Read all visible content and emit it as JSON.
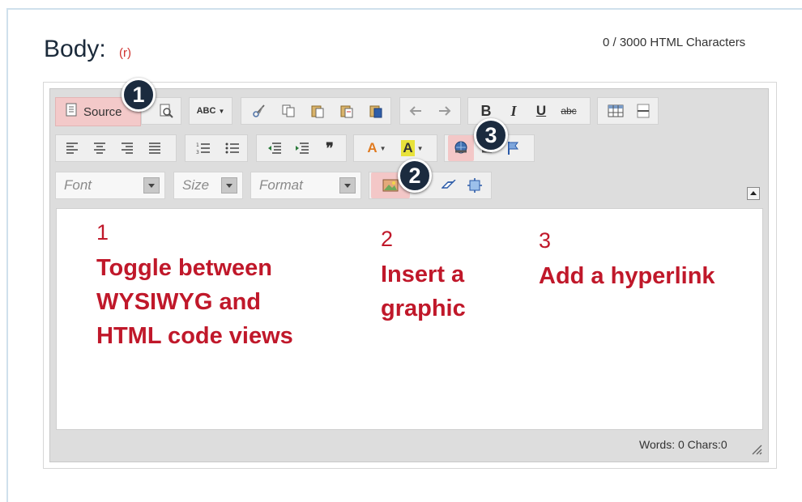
{
  "field": {
    "label": "Body:",
    "required_marker": "(r)",
    "char_counter": "0 / 3000 HTML Characters"
  },
  "toolbar": {
    "source_label": "Source",
    "font_placeholder": "Font",
    "size_placeholder": "Size",
    "format_placeholder": "Format"
  },
  "icons": {
    "row1": [
      "source-icon",
      "preview-icon",
      "spellcheck-icon",
      "cut-icon",
      "copy-icon",
      "paste-icon",
      "paste-text-icon",
      "paste-word-icon",
      "undo-icon",
      "redo-icon",
      "bold-icon",
      "italic-icon",
      "underline-icon",
      "strikethrough-icon",
      "table-icon",
      "horizontal-rule-icon"
    ],
    "row2": [
      "align-left-icon",
      "align-center-icon",
      "align-right-icon",
      "justify-icon",
      "numbered-list-icon",
      "bulleted-list-icon",
      "outdent-icon",
      "indent-icon",
      "blockquote-icon",
      "text-color-icon",
      "background-color-icon",
      "link-icon",
      "unlink-icon",
      "anchor-icon"
    ],
    "row3": [
      "image-icon",
      "eraser-icon",
      "maximize-icon"
    ]
  },
  "toolbar_glyphs": {
    "spellcheck": "ABC",
    "bold": "B",
    "italic": "I",
    "underline": "U",
    "strike": "abc",
    "quote": "❞",
    "text_color": "A",
    "bg_color": "A"
  },
  "annotations": [
    {
      "number": "1",
      "text_lines": [
        "Toggle between",
        "WYSIWYG and",
        "HTML code views"
      ]
    },
    {
      "number": "2",
      "text_lines": [
        "Insert a",
        "graphic"
      ]
    },
    {
      "number": "3",
      "text_lines": [
        "Add a hyperlink"
      ]
    }
  ],
  "badges": [
    "1",
    "2",
    "3"
  ],
  "status_bar": {
    "text": "Words: 0 Chars:0"
  },
  "colors": {
    "annotation_red": "#c0182a",
    "badge_navy": "#1b2b3f",
    "highlight_pink": "#f3c7c7"
  }
}
